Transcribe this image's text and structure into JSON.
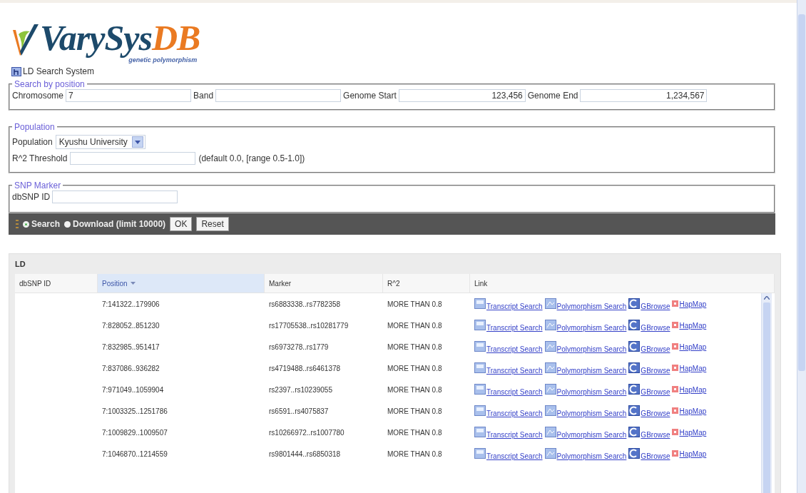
{
  "logo": {
    "name_part_1": "VarySys",
    "name_part_2": "DB",
    "tagline": "genetic polymorphism"
  },
  "system_title": "LD Search System",
  "search_by_position": {
    "legend": "Search by position",
    "fields": [
      {
        "label": "Chromosome",
        "value": "7",
        "kind": "text"
      },
      {
        "label": "Band",
        "kind": "text"
      },
      {
        "label": "Genome Start",
        "value": "123,456",
        "kind": "number"
      },
      {
        "label": "Genome End",
        "value": "1,234,567",
        "kind": "number"
      }
    ]
  },
  "population": {
    "legend": "Population",
    "population_label": "Population",
    "population_value": "Kyushu University",
    "threshold_label": "R^2 Threshold",
    "threshold_hint": "(default 0.0, [range 0.5-1.0])"
  },
  "snp_marker": {
    "legend": "SNP Marker",
    "label": "dbSNP ID"
  },
  "actions": {
    "modes": [
      {
        "label": "Search",
        "selected": true
      },
      {
        "label": "Download (limit 10000)",
        "selected": false
      }
    ],
    "buttons": [
      "OK",
      "Reset"
    ]
  },
  "ld_panel": {
    "title": "LD",
    "columns": [
      {
        "label": "dbSNP ID",
        "sorted": false
      },
      {
        "label": "Position",
        "sorted": true
      },
      {
        "label": "Marker",
        "sorted": false
      },
      {
        "label": "R^2",
        "sorted": false
      },
      {
        "label": "Link",
        "sorted": false
      }
    ],
    "rows": [
      {
        "position": "7:141322..179906",
        "marker": "rs6883338..rs7782358",
        "r2": "MORE THAN 0.8",
        "links": [
          {
            "label": "Transcript Search",
            "kind": "transcript"
          },
          {
            "label": "Polymorphism Search",
            "kind": "polymorphism"
          },
          {
            "label": "GBrowse",
            "kind": "gbrowse"
          },
          {
            "label": "HapMap",
            "kind": "hapmap"
          }
        ]
      },
      {
        "position": "7:828052..851230",
        "marker": "rs17705538..rs10281779",
        "r2": "MORE THAN 0.8",
        "links": [
          {
            "label": "Transcript Search",
            "kind": "transcript"
          },
          {
            "label": "Polymorphism Search",
            "kind": "polymorphism"
          },
          {
            "label": "GBrowse",
            "kind": "gbrowse"
          },
          {
            "label": "HapMap",
            "kind": "hapmap"
          }
        ]
      },
      {
        "position": "7:832985..951417",
        "marker": "rs6973278..rs1779",
        "r2": "MORE THAN 0.8",
        "links": [
          {
            "label": "Transcript Search",
            "kind": "transcript"
          },
          {
            "label": "Polymorphism Search",
            "kind": "polymorphism"
          },
          {
            "label": "GBrowse",
            "kind": "gbrowse"
          },
          {
            "label": "HapMap",
            "kind": "hapmap"
          }
        ]
      },
      {
        "position": "7:837086..936282",
        "marker": "rs4719488..rs6461378",
        "r2": "MORE THAN 0.8",
        "links": [
          {
            "label": "Transcript Search",
            "kind": "transcript"
          },
          {
            "label": "Polymorphism Search",
            "kind": "polymorphism"
          },
          {
            "label": "GBrowse",
            "kind": "gbrowse"
          },
          {
            "label": "HapMap",
            "kind": "hapmap"
          }
        ]
      },
      {
        "position": "7:971049..1059904",
        "marker": "rs2397..rs10239055",
        "r2": "MORE THAN 0.8",
        "links": [
          {
            "label": "Transcript Search",
            "kind": "transcript"
          },
          {
            "label": "Polymorphism Search",
            "kind": "polymorphism"
          },
          {
            "label": "GBrowse",
            "kind": "gbrowse"
          },
          {
            "label": "HapMap",
            "kind": "hapmap"
          }
        ]
      },
      {
        "position": "7:1003325..1251786",
        "marker": "rs6591..rs4075837",
        "r2": "MORE THAN 0.8",
        "links": [
          {
            "label": "Transcript Search",
            "kind": "transcript"
          },
          {
            "label": "Polymorphism Search",
            "kind": "polymorphism"
          },
          {
            "label": "GBrowse",
            "kind": "gbrowse"
          },
          {
            "label": "HapMap",
            "kind": "hapmap"
          }
        ]
      },
      {
        "position": "7:1009829..1009507",
        "marker": "rs10266972..rs1007780",
        "r2": "MORE THAN 0.8",
        "links": [
          {
            "label": "Transcript Search",
            "kind": "transcript"
          },
          {
            "label": "Polymorphism Search",
            "kind": "polymorphism"
          },
          {
            "label": "GBrowse",
            "kind": "gbrowse"
          },
          {
            "label": "HapMap",
            "kind": "hapmap"
          }
        ]
      },
      {
        "position": "7:1046870..1214559",
        "marker": "rs9801444..rs6850318",
        "r2": "MORE THAN 0.8",
        "links": [
          {
            "label": "Transcript Search",
            "kind": "transcript"
          },
          {
            "label": "Polymorphism Search",
            "kind": "polymorphism"
          },
          {
            "label": "GBrowse",
            "kind": "gbrowse"
          },
          {
            "label": "HapMap",
            "kind": "hapmap"
          }
        ]
      }
    ]
  }
}
